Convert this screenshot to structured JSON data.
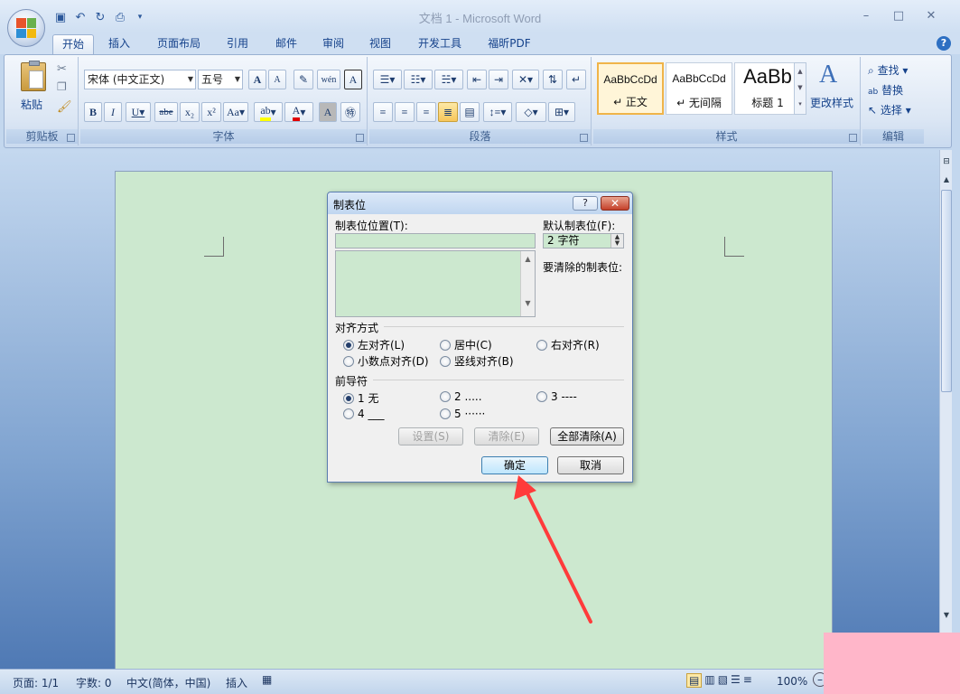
{
  "window": {
    "title": "文档 1 - Microsoft Word",
    "min_label": "–",
    "max_label": "□",
    "close_label": "✕"
  },
  "tabs": [
    {
      "label": "开始",
      "active": true
    },
    {
      "label": "插入"
    },
    {
      "label": "页面布局"
    },
    {
      "label": "引用"
    },
    {
      "label": "邮件"
    },
    {
      "label": "审阅"
    },
    {
      "label": "视图"
    },
    {
      "label": "开发工具"
    },
    {
      "label": "福昕PDF"
    }
  ],
  "ribbon": {
    "clipboard": {
      "label": "剪贴板",
      "paste": "粘贴"
    },
    "font": {
      "label": "字体",
      "font_name": "宋体 (中文正文)",
      "font_size": "五号"
    },
    "paragraph": {
      "label": "段落"
    },
    "styles": {
      "label": "样式",
      "items": [
        {
          "sample": "AaBbCcDd",
          "name": "↵ 正文"
        },
        {
          "sample": "AaBbCcDd",
          "name": "↵ 无间隔"
        },
        {
          "sample": "AaBb",
          "name": "标题 1"
        }
      ],
      "change": "更改样式"
    },
    "editing": {
      "label": "编辑",
      "find": "查找",
      "replace": "替换",
      "select": "选择"
    }
  },
  "dialog": {
    "title": "制表位",
    "help": "?",
    "close": "✕",
    "tab_position_label": "制表位位置(T):",
    "default_tab_label": "默认制表位(F):",
    "default_tab_value": "2 字符",
    "clear_label": "要清除的制表位:",
    "alignment_label": "对齐方式",
    "alignment": [
      {
        "label": "左对齐(L)",
        "selected": true
      },
      {
        "label": "居中(C)"
      },
      {
        "label": "右对齐(R)"
      },
      {
        "label": "小数点对齐(D)"
      },
      {
        "label": "竖线对齐(B)"
      }
    ],
    "leader_label": "前导符",
    "leaders": [
      {
        "label": "1 无",
        "selected": true
      },
      {
        "label": "2 ....."
      },
      {
        "label": "3 ----"
      },
      {
        "label": "4 ___"
      },
      {
        "label": "5 ······"
      }
    ],
    "set_button": "设置(S)",
    "clear_button": "清除(E)",
    "clear_all_button": "全部清除(A)",
    "ok_button": "确定",
    "cancel_button": "取消"
  },
  "statusbar": {
    "page": "页面: 1/1",
    "words": "字数: 0",
    "language": "中文(简体，中国)",
    "insert": "插入",
    "zoom": "100%"
  },
  "colors": {
    "doc_background": "#cce8cf",
    "annotation_arrow": "#ff3b3b",
    "accent": "#15428b"
  }
}
